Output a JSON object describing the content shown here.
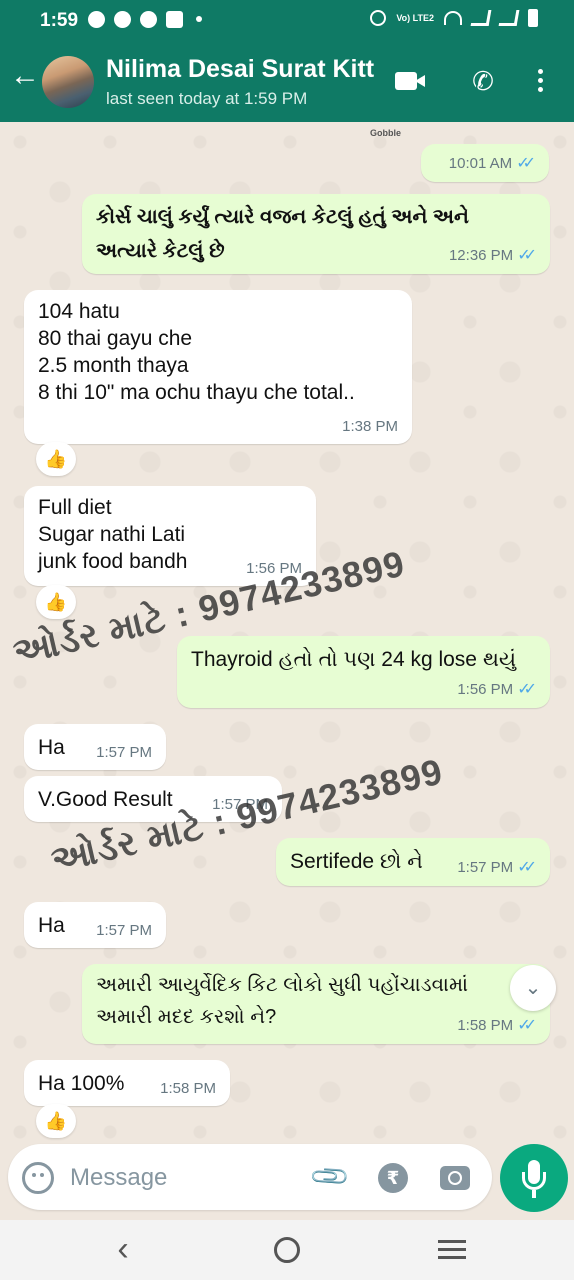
{
  "status_bar": {
    "time": "1:59",
    "network_label": "Vo) LTE2"
  },
  "header": {
    "contact_name": "Nilima Desai Surat Kitt",
    "last_seen": "last seen today at 1:59 PM"
  },
  "doodle_label": "Gobble",
  "messages": [
    {
      "direction": "out",
      "text": "",
      "time": "10:01 AM"
    },
    {
      "direction": "out",
      "text": "કોર્સ ચાલું કર્યું ત્યારે વજન કેટલું હતું અને  અને\nઅત્યારે કેટલું છે",
      "time": "12:36 PM"
    },
    {
      "direction": "in",
      "text": "104 hatu\n80 thai gayu che\n2.5 month  thaya\n8 thi 10\" ma  ochu thayu che total..",
      "time": "1:38 PM",
      "reaction": "👍"
    },
    {
      "direction": "in",
      "text": "Full diet\nSugar nathi Lati\n junk food  bandh",
      "time": "1:56 PM",
      "reaction": "👍"
    },
    {
      "direction": "out",
      "text": "Thayroid હતો તો પણ 24 kg lose થયું",
      "time": "1:56 PM"
    },
    {
      "direction": "in",
      "text": "Ha",
      "time": "1:57 PM"
    },
    {
      "direction": "in",
      "text": "V.Good Result",
      "time": "1:57 PM"
    },
    {
      "direction": "out",
      "text": "Sertifede છો ને",
      "time": "1:57 PM"
    },
    {
      "direction": "in",
      "text": "Ha",
      "time": "1:57 PM"
    },
    {
      "direction": "out",
      "text": "અમારી આયુર્વેદિક કિટ લોકો સુધી પહોંચાડવામાં\nઅમારી મદદ કરશો ને?",
      "time": "1:58 PM"
    },
    {
      "direction": "in",
      "text": "Ha 100%",
      "time": "1:58 PM",
      "reaction": "👍"
    }
  ],
  "watermarks": [
    "ઓર્ડર માટે : 9974233899",
    "ઓર્ડર માટે : 9974233899"
  ],
  "input": {
    "placeholder": "Message"
  },
  "icons": {
    "back": "arrow-left-icon",
    "video": "video-call-icon",
    "call": "phone-icon",
    "menu": "more-vert-icon",
    "emoji": "emoji-icon",
    "attach": "paperclip-icon",
    "payment": "rupee-icon",
    "camera": "camera-icon",
    "mic": "mic-icon"
  },
  "colors": {
    "header": "#0f7a65",
    "outgoing_bubble": "#e7fdd3",
    "incoming_bubble": "#ffffff",
    "read_ticks": "#4fa8e8",
    "mic_button": "#0aa97f"
  }
}
